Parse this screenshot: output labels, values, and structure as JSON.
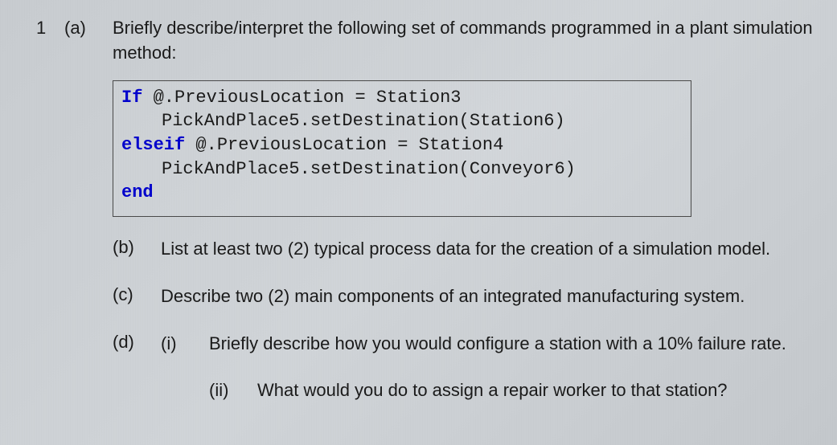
{
  "question": {
    "number": "1",
    "parts": {
      "a": {
        "label": "(a)",
        "text": "Briefly describe/interpret the following set of commands programmed in a plant simulation method:"
      },
      "b": {
        "label": "(b)",
        "text": "List at least two (2) typical process data for the creation of a simulation model."
      },
      "c": {
        "label": "(c)",
        "text": "Describe two (2) main components of an integrated manufacturing system."
      },
      "d": {
        "label": "(d)",
        "sub": {
          "i": {
            "label": "(i)",
            "text": "Briefly describe how you would configure a station with a 10% failure rate."
          },
          "ii": {
            "label": "(ii)",
            "text": "What would you do to assign a repair worker to that station?"
          }
        }
      }
    }
  },
  "code": {
    "line1_keyword": "If",
    "line1_rest": " @.PreviousLocation = Station3",
    "line2": "PickAndPlace5.setDestination(Station6)",
    "line3_keyword": "elseif",
    "line3_rest": " @.PreviousLocation = Station4",
    "line4": "PickAndPlace5.setDestination(Conveyor6)",
    "line5_keyword": "end"
  }
}
